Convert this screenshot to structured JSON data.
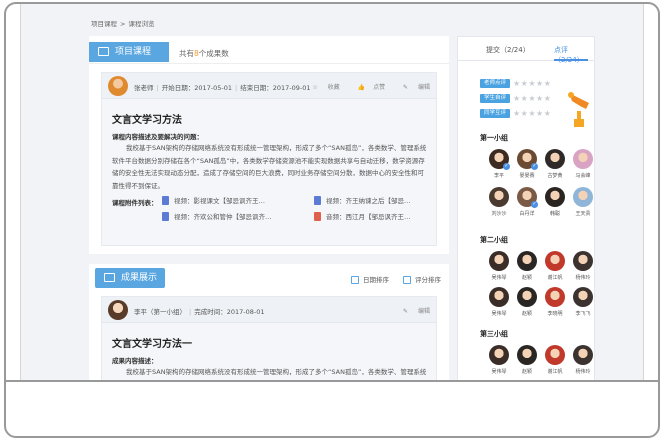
{
  "breadcrumb": [
    "项目课程",
    ">",
    "课程浏览"
  ],
  "project": {
    "tab_label": "项目课程",
    "count_prefix": "共有",
    "count": "8",
    "count_suffix": "个成果数"
  },
  "post1": {
    "author": "张老师",
    "start_date": "开始日期：2017-05-01",
    "end_date": "结束日期：2017-09-01",
    "actions": [
      "收藏",
      "点赞",
      "编辑"
    ],
    "title": "文言文学习方法",
    "subtitle": "课程内容描述及要解决的问题：",
    "body": "我校基于SAN架构的存储网络系统没有形成统一管理架构，形成了多个“SAN孤岛”，各类数学、管理系统软件平台数据分别存储在各个“SAN孤岛”中，各类数学存储资源池不能实现数据共享与自动迁移，数学资源存储的安全性无法实现动态分配，造成了存储空间的巨大浪费，同时业务存储空间分散，数据中心的安全性和可靠性得不到保证。",
    "attach_label": "课程附件列表：",
    "attachments": [
      {
        "name": "视频：影视课文【邹忌讽齐王…",
        "color": "#5b7bd5"
      },
      {
        "name": "视频：齐王纳谏之后【邹忌…",
        "color": "#5b7bd5"
      },
      {
        "name": "视频：齐欢公和管仲【邹忌讽齐…",
        "color": "#5b7bd5"
      },
      {
        "name": "音频：西江月【邹忌讽齐王…",
        "color": "#e0604e"
      }
    ]
  },
  "results": {
    "tab_label": "成果展示",
    "sort_date": "日期排序",
    "sort_score": "评分排序"
  },
  "post2": {
    "author": "李平（第一小组）",
    "done_time": "完成时间：2017-08-01",
    "actions": [
      "编辑"
    ],
    "title": "文言文学习方法一",
    "subtitle": "成果内容描述：",
    "body": "我校基于SAN架构的存储网络系统没有形成统一管理架构，形成了多个“SAN孤岛”，各类数学、管理系统软件平台数据分别存储在各个“SAN孤岛”中，各类数学存储资源池不能实现数据共享与自动迁移，数学"
  },
  "side": {
    "tab_submit": "提交（2/24）",
    "tab_review": "点评（2/24）",
    "evaluations": [
      "老师点评",
      "学生自评",
      "同学互评"
    ],
    "stars": "★★★★★",
    "groups": [
      {
        "title": "第一小组",
        "members": [
          "李平",
          "晏晏赛",
          "古梦黄",
          "马会峰",
          "刘沙沙",
          "白丹洋",
          "韩聪",
          "王天贵"
        ]
      },
      {
        "title": "第二小组",
        "members": [
          "吴伟琴",
          "赵颖",
          "谢江帆",
          "杨伟玲",
          "吴伟琴",
          "赵颖",
          "李晓明",
          "李飞飞"
        ]
      },
      {
        "title": "第三小组",
        "members": [
          "吴伟琴",
          "赵颖",
          "谢江帆",
          "杨伟玲"
        ]
      }
    ]
  },
  "colors": {
    "accent": "#5aa6e0",
    "count_highlight": "#f39c32",
    "link_blue": "#4a90e2"
  }
}
